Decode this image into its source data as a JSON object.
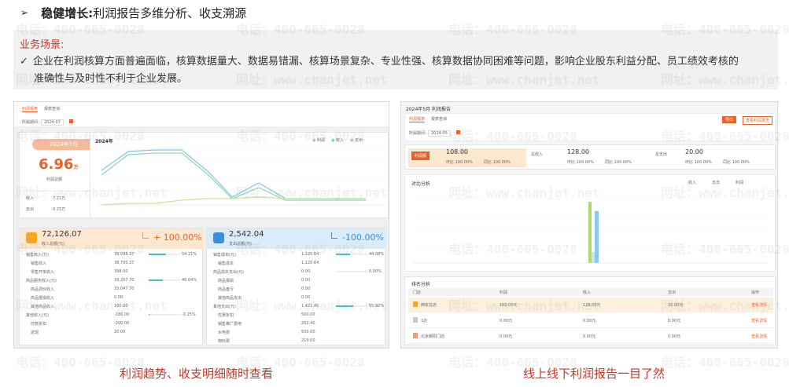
{
  "headline": {
    "arrow": "➢",
    "bold": "稳健增长:",
    "rest": "利润报告多维分析、收支溯源"
  },
  "scene": {
    "title": "业务场景:",
    "check": "✓",
    "line1": "企业在利润核算方面普遍面临，核算数据量大、数据易错漏、核算场景复杂、专业性强、核算数据协同困难等问题，影响企业股东利益分配、员工绩效考核的",
    "line2": "准确性与及时性不利于企业发展。"
  },
  "left_shot": {
    "tabs": [
      "利润报表",
      "报表查询"
    ],
    "period_label": "所属期间：",
    "period_value": "2024-07",
    "month_badge": "2024年7月",
    "big_value": "6.96",
    "big_unit": "万",
    "big_sub": "利润总额",
    "rows": [
      {
        "label": "收入",
        "value": "7.21万"
      },
      {
        "label": "支出",
        "value": "0.25万"
      }
    ],
    "chart_title": "2024年",
    "legend": [
      "利润",
      "收入",
      "支出"
    ],
    "income": {
      "value": "72,126.07",
      "label": "收入总额(元)",
      "change": "+ 100.00%",
      "items": [
        {
          "label": "销售收入(元)",
          "value": "39,098.37",
          "pct": "54.21%"
        },
        {
          "label": "销售收入",
          "value": "38,700.37",
          "pct": ""
        },
        {
          "label": "零售开单收入",
          "value": "398.00",
          "pct": ""
        },
        {
          "label": "商品服务收入(元)",
          "value": "33,207.70",
          "pct": "46.04%"
        },
        {
          "label": "商品调价收入",
          "value": "33,047.70",
          "pct": ""
        },
        {
          "label": "商品报损收入",
          "value": "0.00",
          "pct": ""
        },
        {
          "label": "其他商品收入",
          "value": "160.00",
          "pct": ""
        },
        {
          "label": "其他收入(元)",
          "value": "-180.00",
          "pct": "-0.25%"
        },
        {
          "label": "付款折扣",
          "value": "-200.00",
          "pct": ""
        },
        {
          "label": "返现",
          "value": "20.00",
          "pct": ""
        }
      ]
    },
    "expense": {
      "value": "2,542.04",
      "label": "支出总额(元)",
      "change": "-100.00%",
      "items": [
        {
          "label": "销售成本(元)",
          "value": "1,120.64",
          "pct": "44.08%"
        },
        {
          "label": "销售成本",
          "value": "1,120.64",
          "pct": ""
        },
        {
          "label": "商品损失支出(元)",
          "value": "0.00",
          "pct": "0.00%"
        },
        {
          "label": "商品报损",
          "value": "0.00",
          "pct": ""
        },
        {
          "label": "商品盘亏",
          "value": "0.00",
          "pct": ""
        },
        {
          "label": "其他商品支出",
          "value": "0.00",
          "pct": ""
        },
        {
          "label": "其他支出(元)",
          "value": "1,421.40",
          "pct": "55.92%"
        },
        {
          "label": "优惠折扣",
          "value": "500.00",
          "pct": ""
        },
        {
          "label": "销售推广费用",
          "value": "202.40",
          "pct": ""
        },
        {
          "label": "水电费",
          "value": "500.00",
          "pct": ""
        },
        {
          "label": "物料费",
          "value": "219.00",
          "pct": ""
        }
      ]
    }
  },
  "right_shot": {
    "title": "2024年5月 利润报告",
    "tabs": [
      "利润报表",
      "报表查询"
    ],
    "period_label": "所属期间：",
    "period_value": "2024-05",
    "btn_export": "导出",
    "btn_compare": "查看利润报告",
    "kpis": [
      {
        "name": "利润额",
        "value": "108.00",
        "sub1": "环比 100.00%",
        "sub2": "同比 100.00%"
      },
      {
        "name": "总收入",
        "value": "128.00",
        "sub1": "环比 100.00%",
        "sub2": "同比 100.00%"
      },
      {
        "name": "总支出",
        "value": "20.00",
        "sub1": "环比 100.00%",
        "sub2": "同比 100.00%"
      }
    ],
    "compare_title": "对比分析",
    "compare_legend": [
      "收入",
      "支出",
      "利润"
    ],
    "rank_title": "排名分析",
    "rank_headers": [
      "门店",
      "利润",
      "",
      "收入",
      "",
      "支出",
      "",
      "操作"
    ],
    "rank_rows": [
      {
        "store": "西安总店",
        "profit": "100.00元",
        "income": "128.00元",
        "expense": "20.00元",
        "op": "查看详情"
      },
      {
        "store": "1店",
        "profit": "0.00元",
        "income": "0.00元",
        "expense": "0.00元",
        "op": "查看详情"
      },
      {
        "store": "北京朝阳门店",
        "profit": "0.00元",
        "income": "0.00元",
        "expense": "0.00元",
        "op": "查看详情"
      }
    ]
  },
  "captions": {
    "left": "利润趋势、收支明细随时查看",
    "right": "线上线下利润报告一目了然"
  },
  "watermark": {
    "phone": "电话：400-665-0028",
    "site": "网址：www.chanjet.net"
  }
}
